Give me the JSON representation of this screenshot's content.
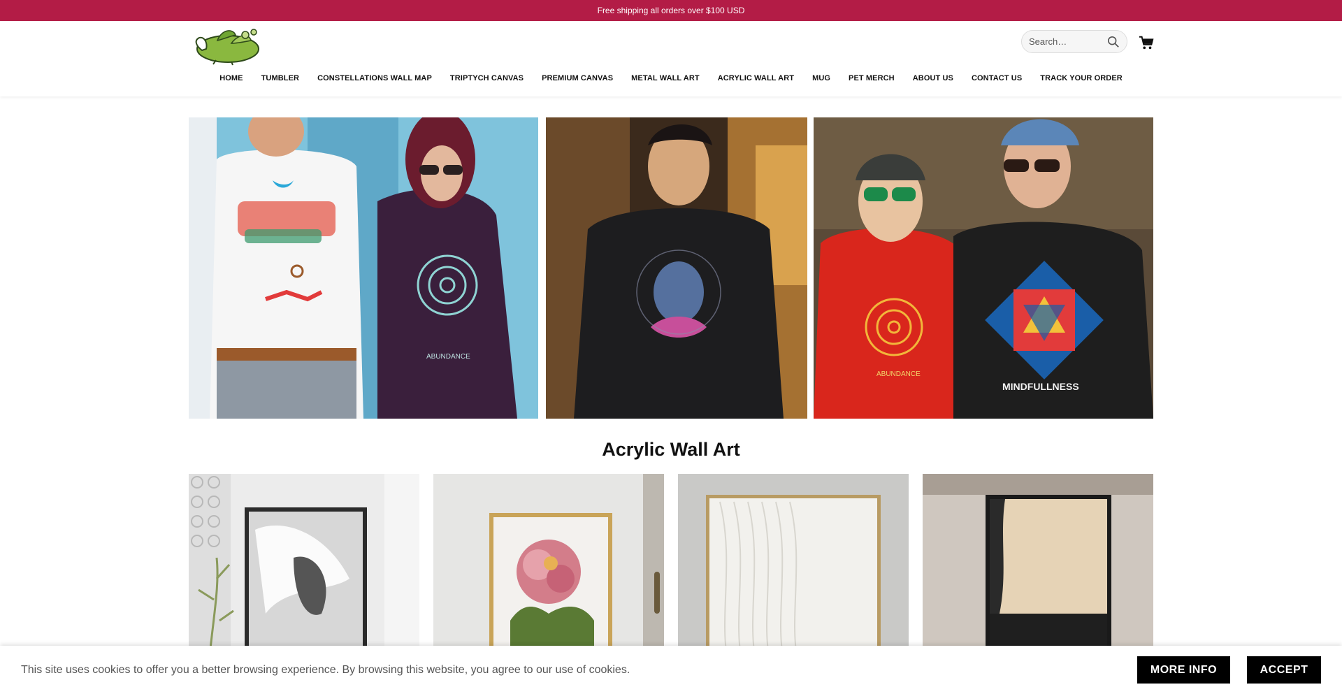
{
  "topbar": {
    "text": "Free shipping all orders over $100 USD"
  },
  "header": {
    "logo_icon": "leaf-logo-icon",
    "search": {
      "placeholder": "Search…",
      "icon": "search-icon"
    },
    "cart_icon": "shopping-cart-icon"
  },
  "nav": {
    "items": [
      {
        "label": "HOME"
      },
      {
        "label": "TUMBLER"
      },
      {
        "label": "CONSTELLATIONS WALL MAP"
      },
      {
        "label": "TRIPTYCH CANVAS"
      },
      {
        "label": "PREMIUM CANVAS"
      },
      {
        "label": "METAL WALL ART"
      },
      {
        "label": "ACRYLIC WALL ART"
      },
      {
        "label": "MUG"
      },
      {
        "label": "PET MERCH"
      },
      {
        "label": "ABOUT US"
      },
      {
        "label": "CONTACT US"
      },
      {
        "label": "TRACK YOUR ORDER"
      }
    ]
  },
  "hero": {
    "panels": [
      {
        "name": "hero-tshirts-image",
        "print_text": "ABUNDANCE"
      },
      {
        "name": "hero-buddha-sweatshirt-image"
      },
      {
        "name": "hero-hoodies-image",
        "print_text_1": "ABUNDANCE",
        "print_text_2": "MINDFULLNESS"
      }
    ]
  },
  "section": {
    "title": "Acrylic Wall Art"
  },
  "products": [
    {
      "name": "product-abstract-gray-image"
    },
    {
      "name": "product-peony-flower-image"
    },
    {
      "name": "product-white-texture-image"
    },
    {
      "name": "product-black-beige-image"
    }
  ],
  "cookie": {
    "message": "This site uses cookies to offer you a better browsing experience. By browsing this website, you agree to our use of cookies.",
    "more_info": "MORE INFO",
    "accept": "ACCEPT"
  }
}
